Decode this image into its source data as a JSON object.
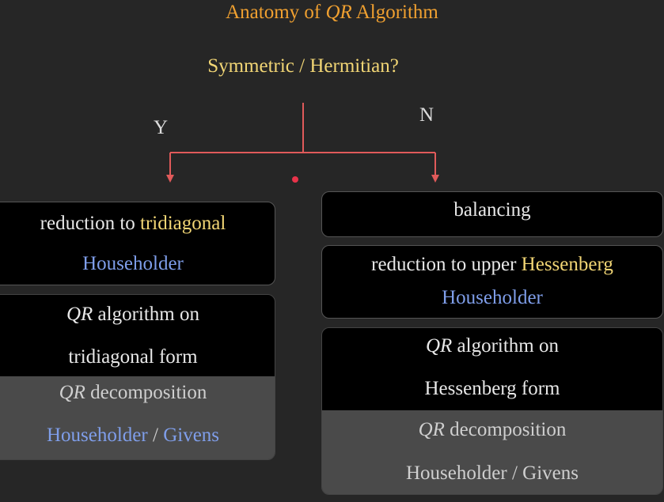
{
  "title": {
    "prefix": "Anatomy of ",
    "italic": "QR",
    "suffix": " Algorithm"
  },
  "question": "Symmetric / Hermitian?",
  "branches": {
    "yes": "Y",
    "no": "N"
  },
  "colors": {
    "background": "#262626",
    "title": "#f0a030",
    "highlight": "#f2d675",
    "blue": "#7f9eea",
    "arrow": "#e05a5a"
  },
  "left": {
    "reduction": {
      "text": "reduction to ",
      "highlight": "tridiagonal",
      "method": "Householder"
    },
    "qr_algorithm": {
      "italic": "QR",
      "text": " algorithm on",
      "line2": "tridiagonal form"
    },
    "qr_decomposition": {
      "italic": "QR",
      "text": " decomposition",
      "method_a": "Householder",
      "sep": " / ",
      "method_b": "Givens"
    }
  },
  "right": {
    "balancing": "balancing",
    "reduction": {
      "text": "reduction to upper ",
      "highlight": "Hessenberg",
      "method": "Householder"
    },
    "qr_algorithm": {
      "italic": "QR",
      "text": " algorithm on",
      "line2": "Hessenberg form"
    },
    "qr_decomposition": {
      "italic": "QR",
      "text": " decomposition",
      "method": "Householder / Givens"
    }
  }
}
